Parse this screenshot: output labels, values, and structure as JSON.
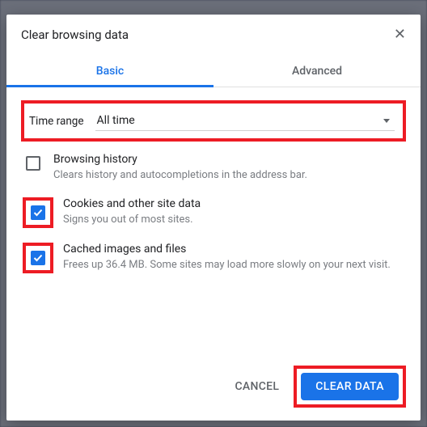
{
  "dialog": {
    "title": "Clear browsing data",
    "tabs": {
      "basic": "Basic",
      "advanced": "Advanced"
    },
    "timerange": {
      "label": "Time range",
      "value": "All time"
    },
    "options": [
      {
        "title": "Browsing history",
        "desc": "Clears history and autocompletions in the address bar.",
        "checked": false,
        "highlight": false
      },
      {
        "title": "Cookies and other site data",
        "desc": "Signs you out of most sites.",
        "checked": true,
        "highlight": true
      },
      {
        "title": "Cached images and files",
        "desc": "Frees up 36.4 MB. Some sites may load more slowly on your next visit.",
        "checked": true,
        "highlight": true
      }
    ],
    "buttons": {
      "cancel": "CANCEL",
      "clear": "CLEAR DATA"
    }
  },
  "colors": {
    "accent": "#1a73e8",
    "highlight": "#ed1c24"
  }
}
